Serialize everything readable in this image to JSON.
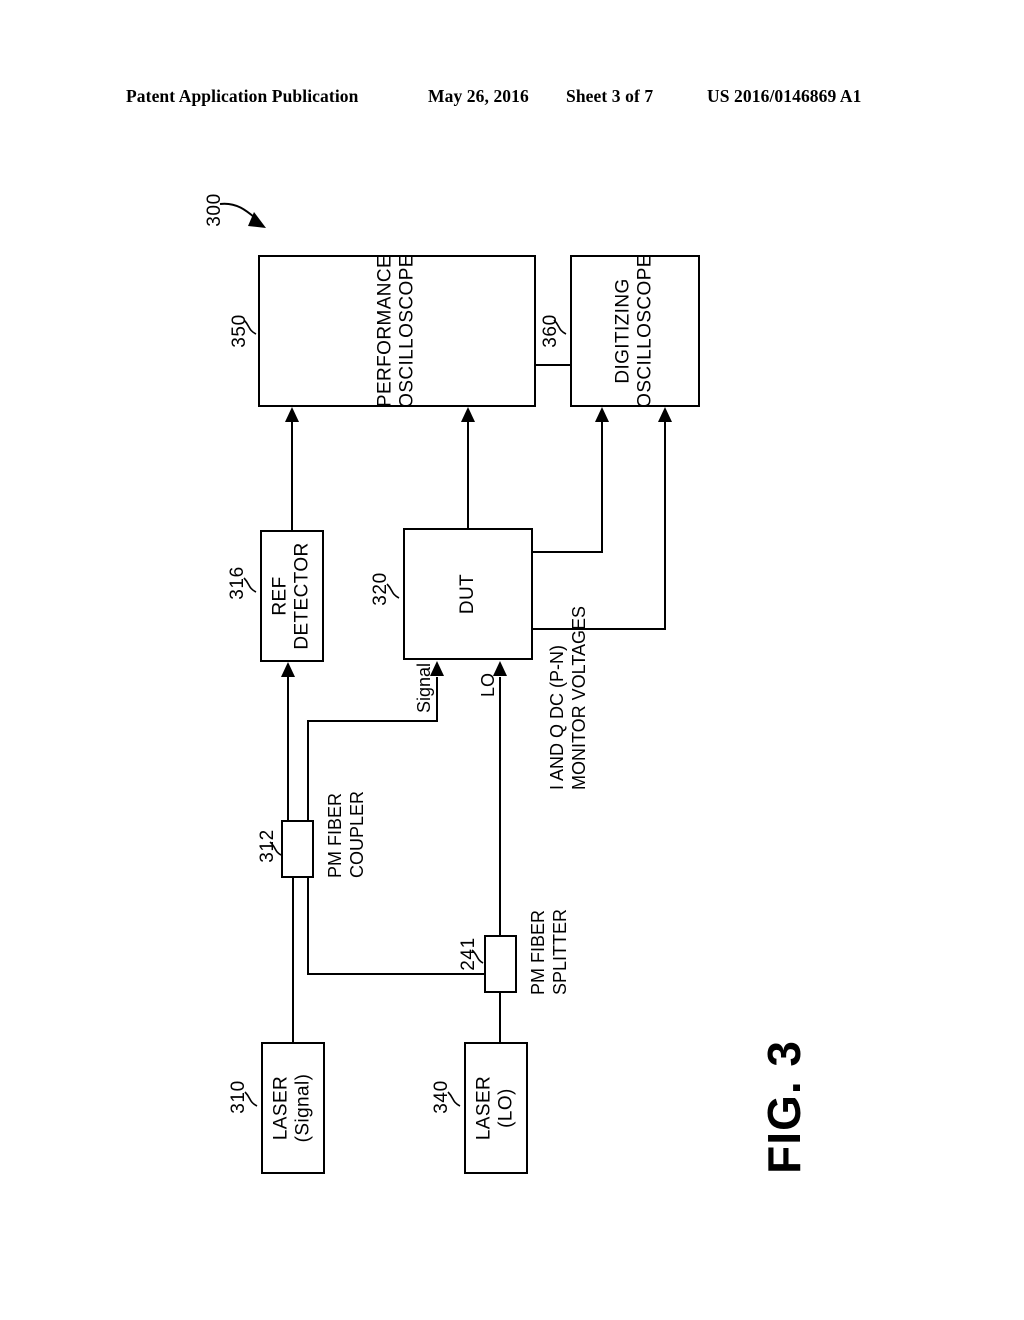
{
  "header": {
    "publication": "Patent Application Publication",
    "date": "May 26, 2016",
    "sheet": "Sheet 3 of 7",
    "patent_number": "US 2016/0146869 A1"
  },
  "figure": {
    "caption": "FIG. 3",
    "system_ref": "300",
    "blocks": [
      {
        "ref": "350",
        "label_line1": "PERFORMANCE",
        "label_line2": "OSCILLOSCOPE"
      },
      {
        "ref": "360",
        "label_line1": "DIGITIZING",
        "label_line2": "OSCILLOSCOPE"
      },
      {
        "ref": "316",
        "label_line1": "REF",
        "label_line2": "DETECTOR"
      },
      {
        "ref": "320",
        "label_line1": "DUT",
        "label_line2": ""
      },
      {
        "ref": "312",
        "label_line1": "PM FIBER",
        "label_line2": "COUPLER"
      },
      {
        "ref": "241",
        "label_line1": "PM FIBER",
        "label_line2": "SPLITTER"
      },
      {
        "ref": "310",
        "label_line1": "LASER",
        "label_line2": "(Signal)"
      },
      {
        "ref": "340",
        "label_line1": "LASER",
        "label_line2": "(LO)"
      }
    ],
    "annotations": {
      "signal": "Signal",
      "lo": "LO",
      "monitor_line1": "I AND Q DC (P-N)",
      "monitor_line2": "MONITOR VOLTAGES"
    }
  },
  "colors": {
    "ink": "#000000",
    "paper": "#ffffff"
  }
}
